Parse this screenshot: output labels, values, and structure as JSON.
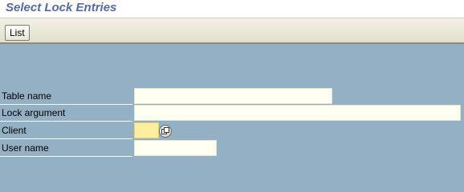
{
  "page": {
    "title": "Select Lock Entries"
  },
  "toolbar": {
    "list_label": "List"
  },
  "form": {
    "table_name_label": "Table name",
    "table_name_value": "",
    "lock_argument_label": "Lock argument",
    "lock_argument_value": "",
    "client_label": "Client",
    "client_value": "",
    "client_value_help_icon": "value-help-icon",
    "user_name_label": "User name",
    "user_name_value": ""
  }
}
